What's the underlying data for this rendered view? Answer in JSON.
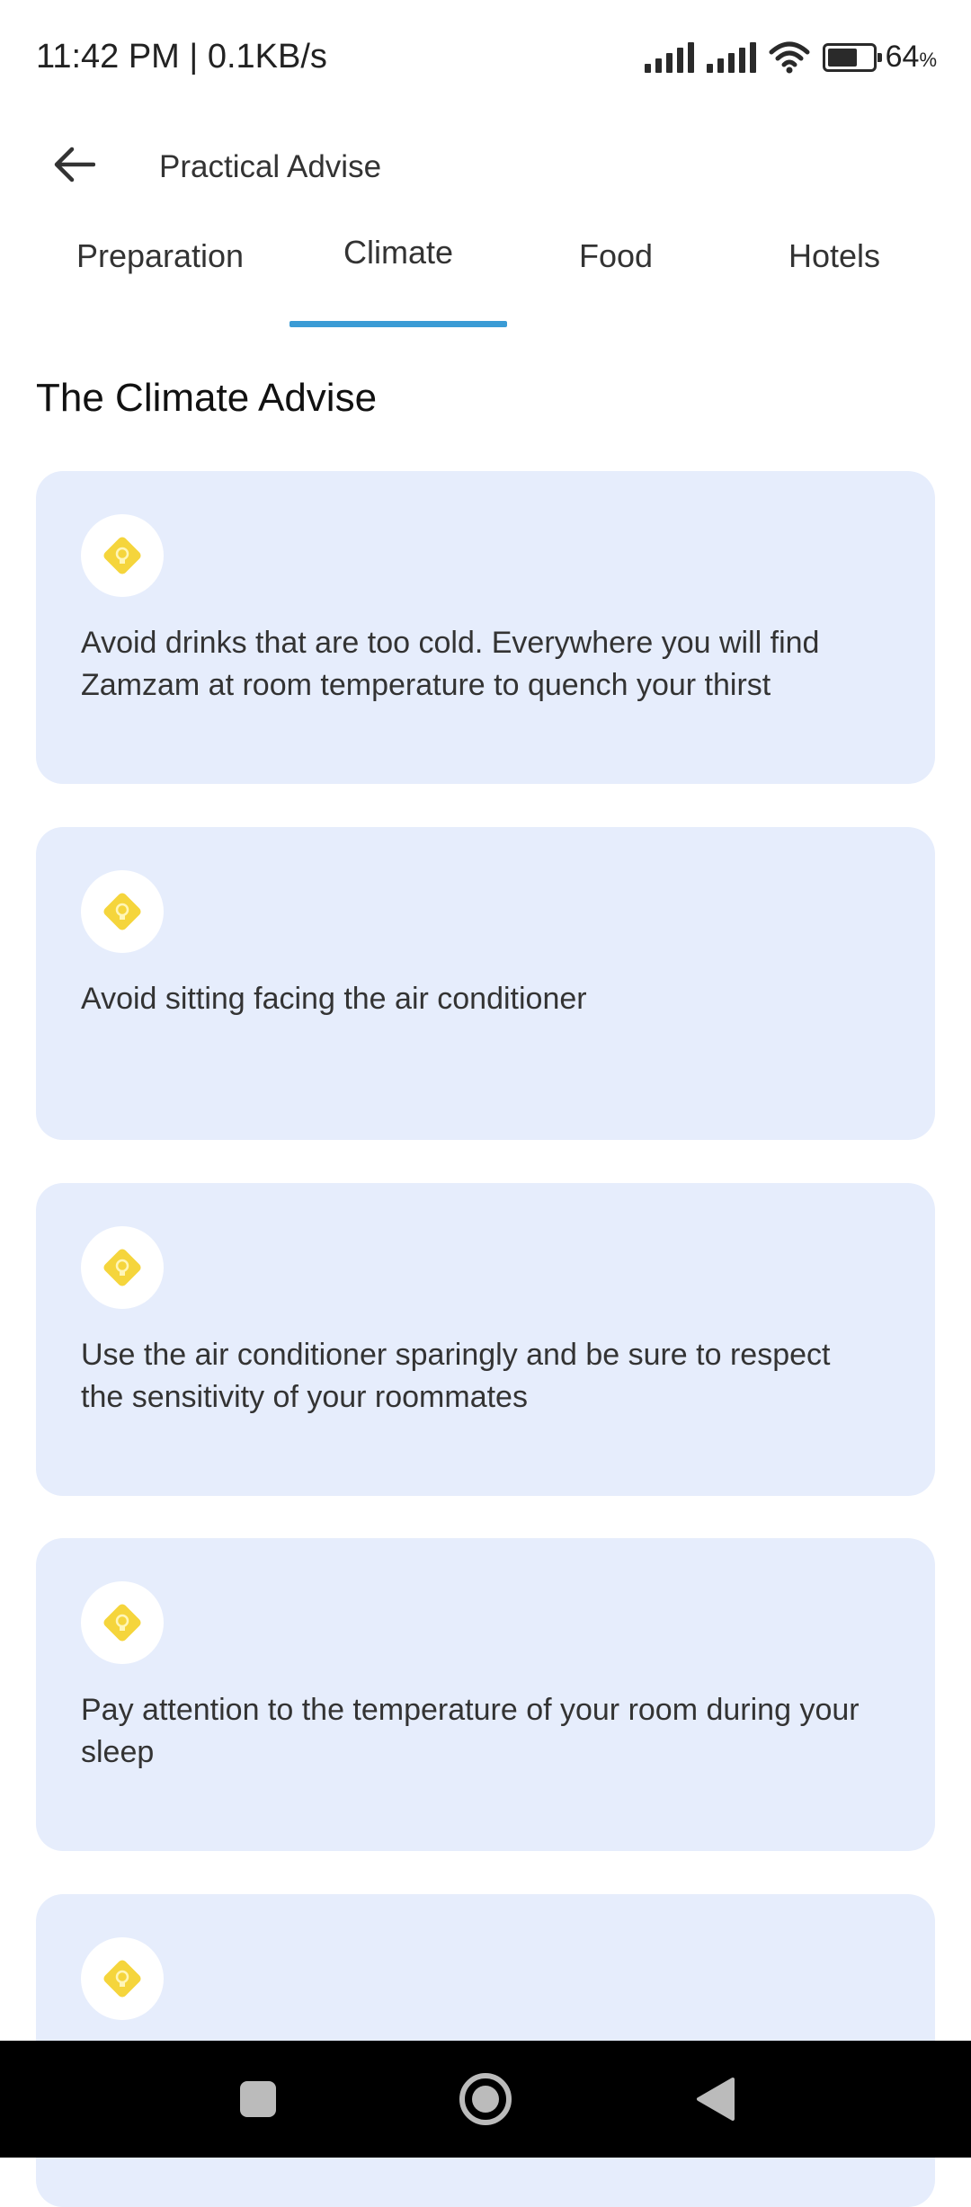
{
  "status_bar": {
    "time": "11:42 PM | 0.1KB/s",
    "battery_level": "64",
    "battery_unit": "%"
  },
  "header": {
    "title": "Practical Advise",
    "back_icon": "arrow-left-icon"
  },
  "tabs": [
    {
      "label": "Preparation",
      "active": false
    },
    {
      "label": "Climate",
      "active": true
    },
    {
      "label": "Food",
      "active": false
    },
    {
      "label": "Hotels",
      "active": false
    }
  ],
  "section": {
    "title": "The Climate Advise"
  },
  "advice_items": [
    {
      "icon": "lightbulb-icon",
      "text": "Avoid drinks that are too cold. Everywhere you will find Zamzam at room temperature to quench your thirst"
    },
    {
      "icon": "lightbulb-icon",
      "text": "Avoid sitting facing the air conditioner"
    },
    {
      "icon": "lightbulb-icon",
      "text": "Use the air conditioner sparingly and be sure to respect the sensitivity of your roommates"
    },
    {
      "icon": "lightbulb-icon",
      "text": "Pay attention to the temperature of your room during your sleep"
    },
    {
      "icon": "lightbulb-icon",
      "text": ""
    }
  ],
  "colors": {
    "accent": "#3a9bd5",
    "card_bg": "#e6edfc",
    "icon_yellow": "#f5d53c"
  }
}
